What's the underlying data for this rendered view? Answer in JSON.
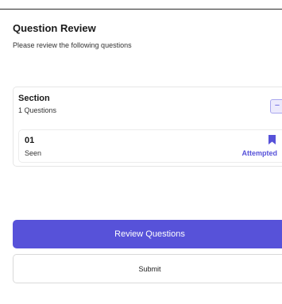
{
  "header": {
    "title": "Question Review",
    "subtitle": "Please review the following questions"
  },
  "section": {
    "name": "Section",
    "count_label": "1 Questions",
    "collapse_symbol": "−",
    "questions": [
      {
        "number": "01",
        "seen_label": "Seen",
        "status": "Attempted",
        "icon": "bookmark-icon"
      }
    ]
  },
  "actions": {
    "review_label": "Review Questions",
    "submit_label": "Submit"
  },
  "colors": {
    "accent": "#5752d9",
    "accent_light": "#eceafc"
  }
}
